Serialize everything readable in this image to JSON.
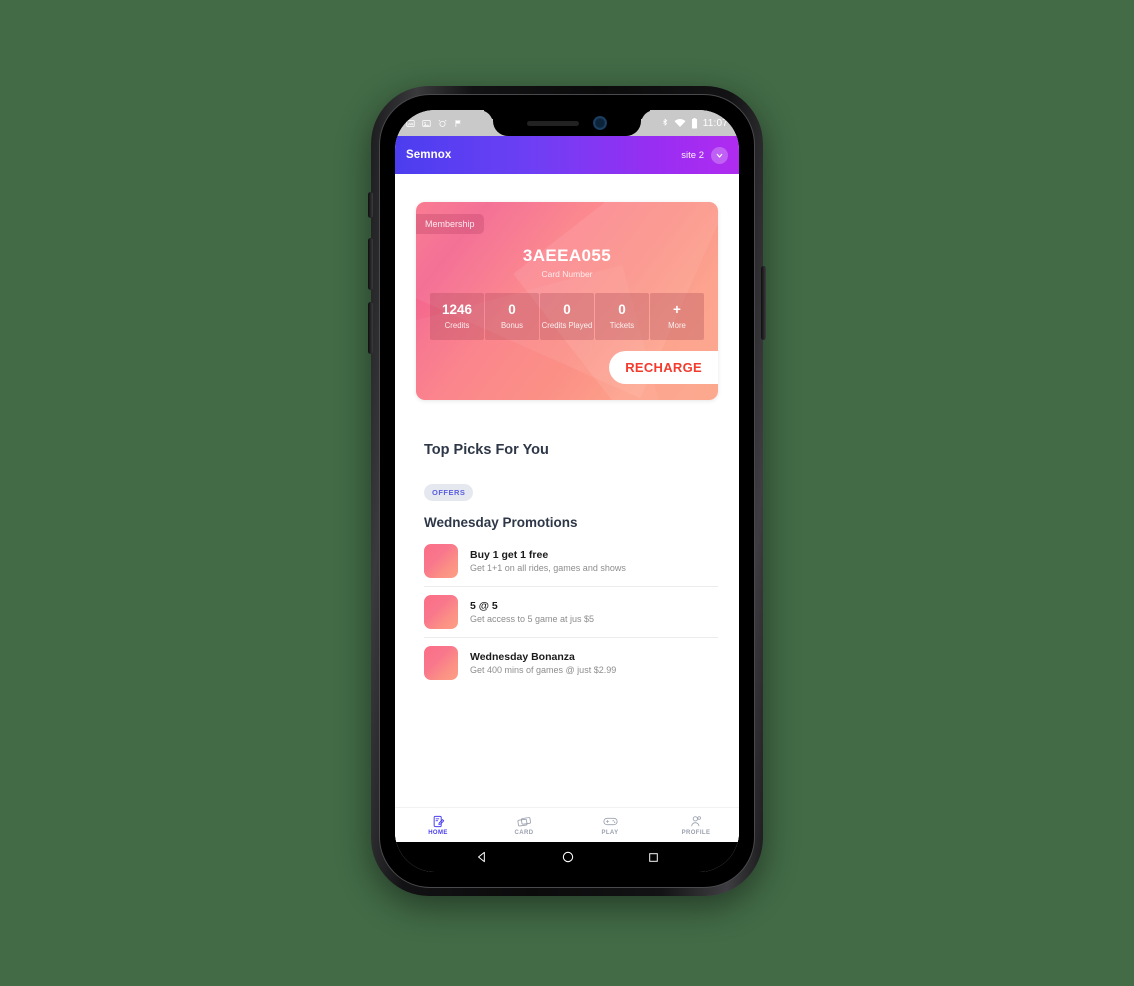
{
  "status_bar": {
    "left_icons": [
      "image-icon",
      "photo-icon",
      "alarm-icon",
      "flag-icon"
    ],
    "right_icons": [
      "bluetooth-icon",
      "wifi-icon",
      "battery-icon"
    ],
    "clock": "11:07"
  },
  "app_bar": {
    "title": "Semnox",
    "site_label": "site 2",
    "chevron_icon": "chevron-down-icon"
  },
  "card": {
    "badge": "Membership",
    "number": "3AEEA055",
    "number_label": "Card Number",
    "stats": [
      {
        "value": "1246",
        "label": "Credits"
      },
      {
        "value": "0",
        "label": "Bonus"
      },
      {
        "value": "0",
        "label": "Credits Played"
      },
      {
        "value": "0",
        "label": "Tickets"
      },
      {
        "value": "+",
        "label": "More"
      }
    ],
    "recharge_label": "RECHARGE",
    "recharge_color": "#f33b2e"
  },
  "top_picks": {
    "section_title": "Top Picks For You",
    "offers_badge": "OFFERS",
    "badge_color": "#5a5fe0",
    "group_title": "Wednesday Promotions",
    "promotions": [
      {
        "title": "Buy 1 get 1 free",
        "subtitle": "Get 1+1 on all rides, games and shows",
        "thumb_icon": "promo-thumbnail"
      },
      {
        "title": "5 @ 5",
        "subtitle": "Get access to 5 game at jus $5",
        "thumb_icon": "promo-thumbnail"
      },
      {
        "title": "Wednesday Bonanza",
        "subtitle": "Get 400 mins of games @ just $2.99",
        "thumb_icon": "promo-thumbnail"
      }
    ]
  },
  "bottom_nav": {
    "active_color": "#4b3ef0",
    "items": [
      {
        "label": "HOME",
        "icon": "home-note-icon"
      },
      {
        "label": "CARD",
        "icon": "cards-icon"
      },
      {
        "label": "PLAY",
        "icon": "gamepad-icon"
      },
      {
        "label": "PROFILE",
        "icon": "profile-icon"
      }
    ]
  },
  "android_nav": {
    "back": "back-triangle-icon",
    "home": "home-circle-icon",
    "recents": "recents-square-icon"
  }
}
